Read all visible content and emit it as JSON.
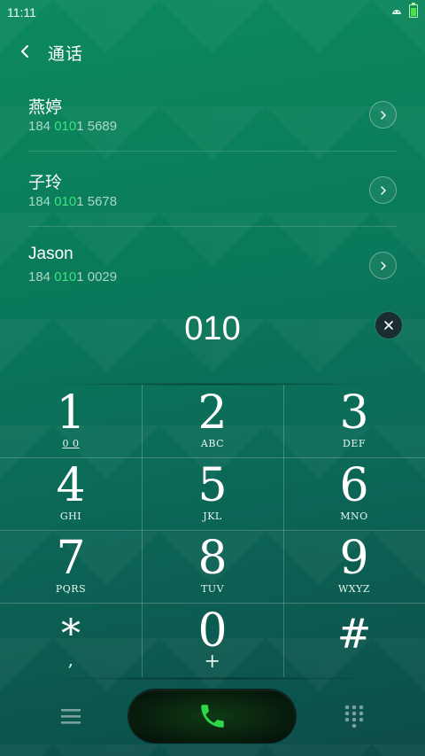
{
  "status": {
    "time": "11:11"
  },
  "header": {
    "title": "通话"
  },
  "contacts": [
    {
      "name": "燕婷",
      "number_prefix": "184 ",
      "number_match": "010",
      "number_suffix": "1 5689"
    },
    {
      "name": "子玲",
      "number_prefix": "184 ",
      "number_match": "010",
      "number_suffix": "1 5678"
    },
    {
      "name": "Jason",
      "number_prefix": "184 ",
      "number_match": "010",
      "number_suffix": "1 0029"
    }
  ],
  "dial": {
    "input": "010"
  },
  "keypad": {
    "keys": [
      {
        "digit": "1",
        "letters": "0 0"
      },
      {
        "digit": "2",
        "letters": "ABC"
      },
      {
        "digit": "3",
        "letters": "DEF"
      },
      {
        "digit": "4",
        "letters": "GHI"
      },
      {
        "digit": "5",
        "letters": "JKL"
      },
      {
        "digit": "6",
        "letters": "MNO"
      },
      {
        "digit": "7",
        "letters": "PQRS"
      },
      {
        "digit": "8",
        "letters": "TUV"
      },
      {
        "digit": "9",
        "letters": "WXYZ"
      },
      {
        "digit": "*",
        "letters": ","
      },
      {
        "digit": "0",
        "letters": "+"
      },
      {
        "digit": "#",
        "letters": ""
      }
    ]
  },
  "colors": {
    "accent": "#3fe17f",
    "call_icon": "#2fd84a"
  },
  "icons": {
    "back": "chevron-left-icon",
    "detail": "chevron-right-icon",
    "clear": "close-icon",
    "menu": "menu-icon",
    "call": "phone-icon",
    "dialpad": "dialpad-icon"
  }
}
